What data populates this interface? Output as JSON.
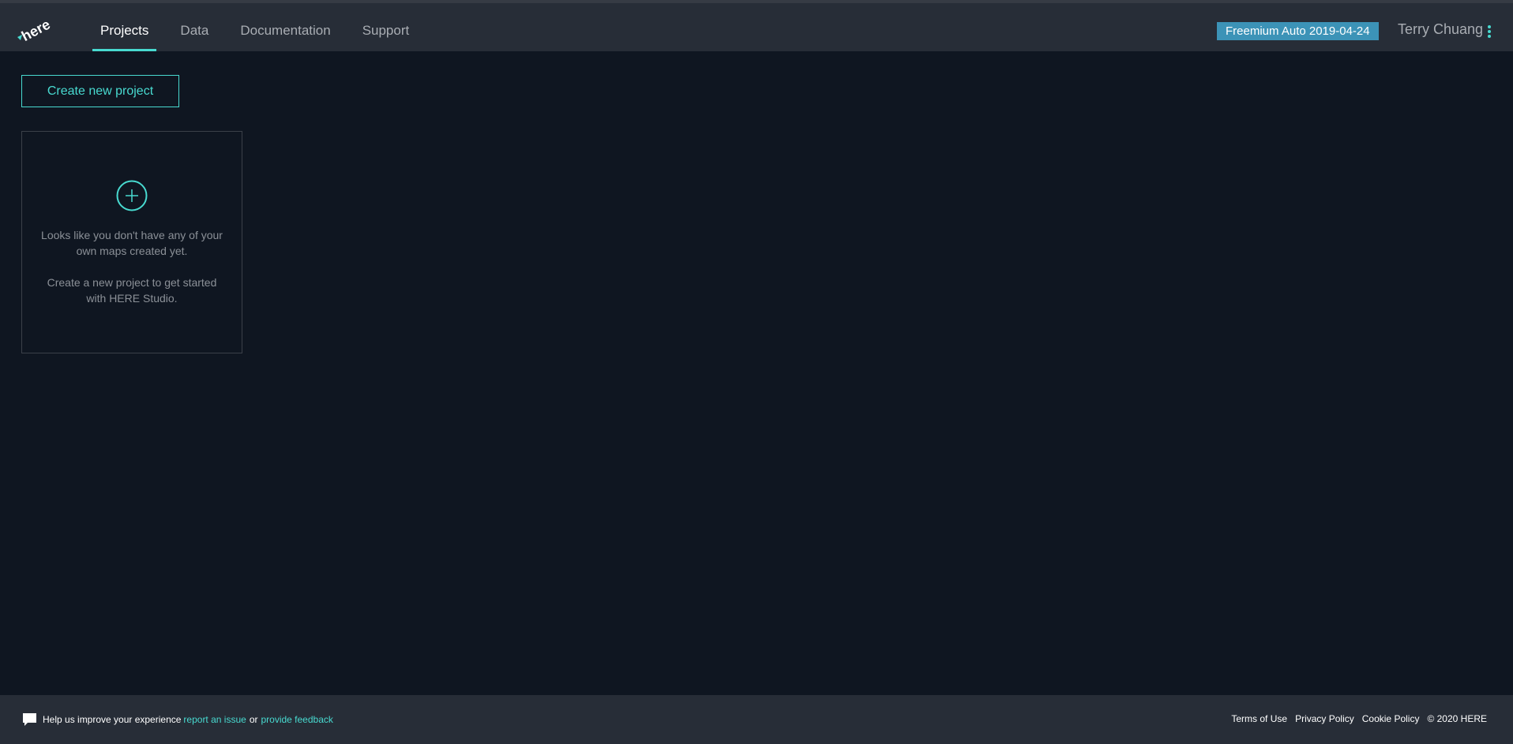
{
  "header": {
    "logo_alt": "here",
    "nav": [
      {
        "label": "Projects",
        "active": true
      },
      {
        "label": "Data",
        "active": false
      },
      {
        "label": "Documentation",
        "active": false
      },
      {
        "label": "Support",
        "active": false
      }
    ],
    "plan_badge": "Freemium Auto 2019-04-24",
    "user_name": "Terry Chuang",
    "user_menu_icon": "kebab-vertical-icon"
  },
  "main": {
    "create_button": "Create new project",
    "empty_state": {
      "icon": "plus-circle-icon",
      "line1": "Looks like you don't have any of your own maps created yet.",
      "line2": "Create a new project to get started with HERE Studio."
    }
  },
  "footer": {
    "feedback_icon": "chat-bubble-icon",
    "help_text": "Help us improve your experience",
    "report_link": "report an issue",
    "or_text": "or",
    "feedback_link": "provide feedback",
    "links": [
      "Terms of Use",
      "Privacy Policy",
      "Cookie Policy"
    ],
    "copyright": "© 2020 HERE"
  },
  "colors": {
    "background": "#0f1621",
    "bar": "#272d37",
    "accent": "#48dad0",
    "badge": "#3c93b7"
  }
}
